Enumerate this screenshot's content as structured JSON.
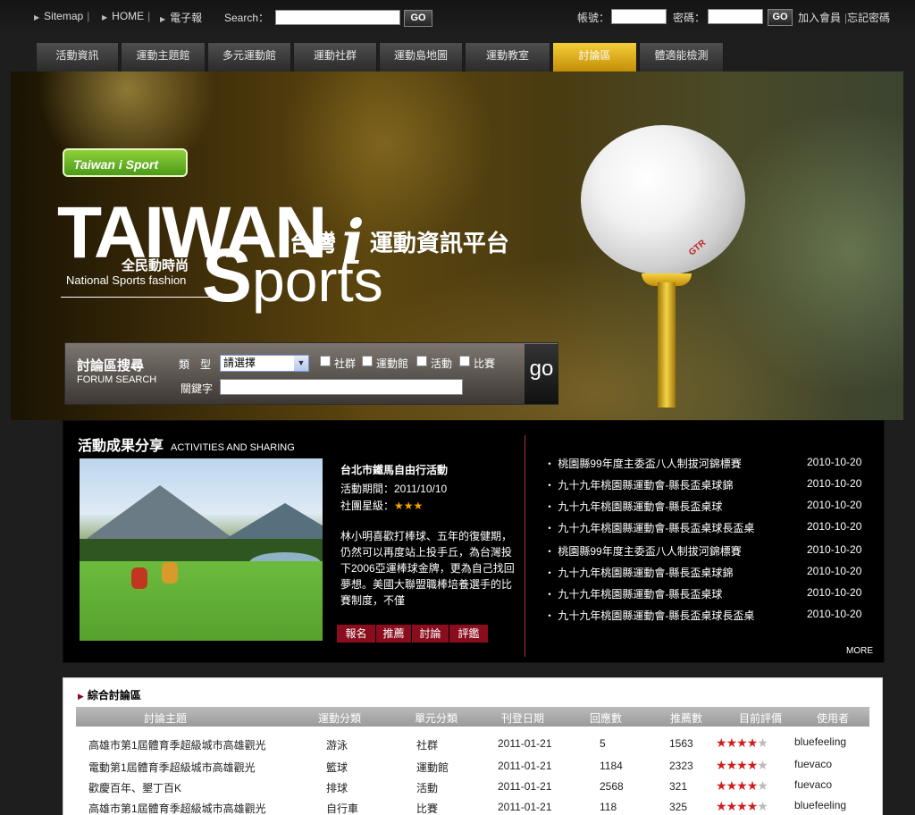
{
  "topbar": {
    "links": [
      "Sitemap",
      "HOME",
      "電子報"
    ],
    "search_label": "Search：",
    "go": "GO",
    "account_label": "帳號：",
    "password_label": "密碼：",
    "join": "加入會員",
    "forgot": "忘記密碼"
  },
  "nav": {
    "tabs": [
      "活動資訊",
      "運動主題館",
      "多元運動館",
      "運動社群",
      "運動島地圖",
      "運動教室",
      "討論區",
      "體適能檢測"
    ],
    "active": "討論區"
  },
  "banner": {
    "logo_small": "Taiwan i Sport",
    "logo_i": "i",
    "big_taiwan": "TAIWAN",
    "big_s": "S",
    "big_ports": "ports",
    "cjk_left": "台灣",
    "cjk_i": "i",
    "cjk_right": "運動資訊平台",
    "tagline_cn": "全民動時尚",
    "tagline_en": "National Sports fashion",
    "ball_logo": "GTR"
  },
  "forum_search": {
    "title_cn": "討論區搜尋",
    "title_en": "FORUM SEARCH",
    "type_label": "類　型",
    "select_value": "請選擇",
    "checkboxes": [
      "社群",
      "運動館",
      "活動",
      "比賽"
    ],
    "keyword_label": "關鍵字",
    "go": "go"
  },
  "activities": {
    "title_cn": "活動成果分享",
    "title_en": "ACTIVITIES AND SHARING",
    "event_title": "台北市鐵馬自由行活動",
    "period": "活動期間：2011/10/10",
    "rating_label": "社團星級：",
    "rating_stars": "★★★",
    "description": "林小明喜歡打棒球、五年的復健期，仍然可以再度站上投手丘，為台灣投下2006亞運棒球金牌，更為自己找回夢想。美國大聯盟職棒培養選手的比賽制度，不僅",
    "buttons": [
      "報名",
      "推薦",
      "討論",
      "評鑑"
    ],
    "news": [
      {
        "title": "桃園縣99年度主委盃八人制拔河錦標賽",
        "date": "2010-10-20"
      },
      {
        "title": "九十九年桃園縣運動會-縣長盃桌球錦",
        "date": "2010-10-20"
      },
      {
        "title": "九十九年桃園縣運動會-縣長盃桌球",
        "date": "2010-10-20"
      },
      {
        "title": "九十九年桃園縣運動會-縣長盃桌球長盃桌",
        "date": "2010-10-20"
      },
      {
        "title": "桃園縣99年度主委盃八人制拔河錦標賽",
        "date": "2010-10-20"
      },
      {
        "title": "九十九年桃園縣運動會-縣長盃桌球錦",
        "date": "2010-10-20"
      },
      {
        "title": "九十九年桃園縣運動會-縣長盃桌球",
        "date": "2010-10-20"
      },
      {
        "title": "九十九年桃園縣運動會-縣長盃桌球長盃桌",
        "date": "2010-10-20"
      }
    ],
    "more": "MORE"
  },
  "forum": {
    "title": "綜合討論區",
    "columns": [
      "討論主題",
      "運動分類",
      "單元分類",
      "刊登日期",
      "回應數",
      "推薦數",
      "目前評價",
      "使用者"
    ],
    "rows": [
      {
        "topic": "高雄市第1屆體育季超級城市高雄觀光",
        "sport": "游泳",
        "unit": "社群",
        "date": "2011-01-21",
        "replies": "5",
        "recommend": "1563",
        "rating": 4,
        "user": "bluefeeling"
      },
      {
        "topic": "電動第1屆體育季超級城市高雄觀光",
        "sport": "籃球",
        "unit": "運動館",
        "date": "2011-01-21",
        "replies": "1184",
        "recommend": "2323",
        "rating": 4,
        "user": "fuevaco"
      },
      {
        "topic": "歡慶百年、墾丁百K",
        "sport": "排球",
        "unit": "活動",
        "date": "2011-01-21",
        "replies": "2568",
        "recommend": "321",
        "rating": 4,
        "user": "fuevaco"
      },
      {
        "topic": "高雄市第1屆體育季超級城市高雄觀光",
        "sport": "自行車",
        "unit": "比賽",
        "date": "2011-01-21",
        "replies": "118",
        "recommend": "325",
        "rating": 4,
        "user": "bluefeeling"
      }
    ]
  }
}
